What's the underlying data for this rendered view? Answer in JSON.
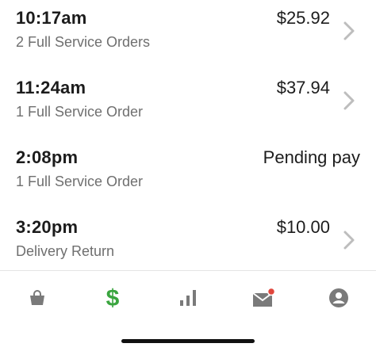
{
  "orders": [
    {
      "time": "10:17am",
      "subtitle": "2 Full Service Orders",
      "amount": "$25.92",
      "has_chevron": true
    },
    {
      "time": "11:24am",
      "subtitle": "1 Full Service Order",
      "amount": "$37.94",
      "has_chevron": true
    },
    {
      "time": "2:08pm",
      "subtitle": "1 Full Service Order",
      "amount": "Pending pay",
      "has_chevron": false
    },
    {
      "time": "3:20pm",
      "subtitle": "Delivery Return",
      "amount": "$10.00",
      "has_chevron": true
    }
  ],
  "tabbar": {
    "tabs": [
      {
        "icon": "shopping-bag-icon",
        "active": false
      },
      {
        "icon": "dollar-icon",
        "active": true
      },
      {
        "icon": "bar-chart-icon",
        "active": false
      },
      {
        "icon": "mail-icon",
        "active": false,
        "badge": true
      },
      {
        "icon": "account-icon",
        "active": false
      }
    ]
  },
  "colors": {
    "active_tab": "#3aa53f",
    "inactive_tab": "#7a7a7a",
    "badge": "#e0463c",
    "chevron": "#bdbdbd"
  }
}
